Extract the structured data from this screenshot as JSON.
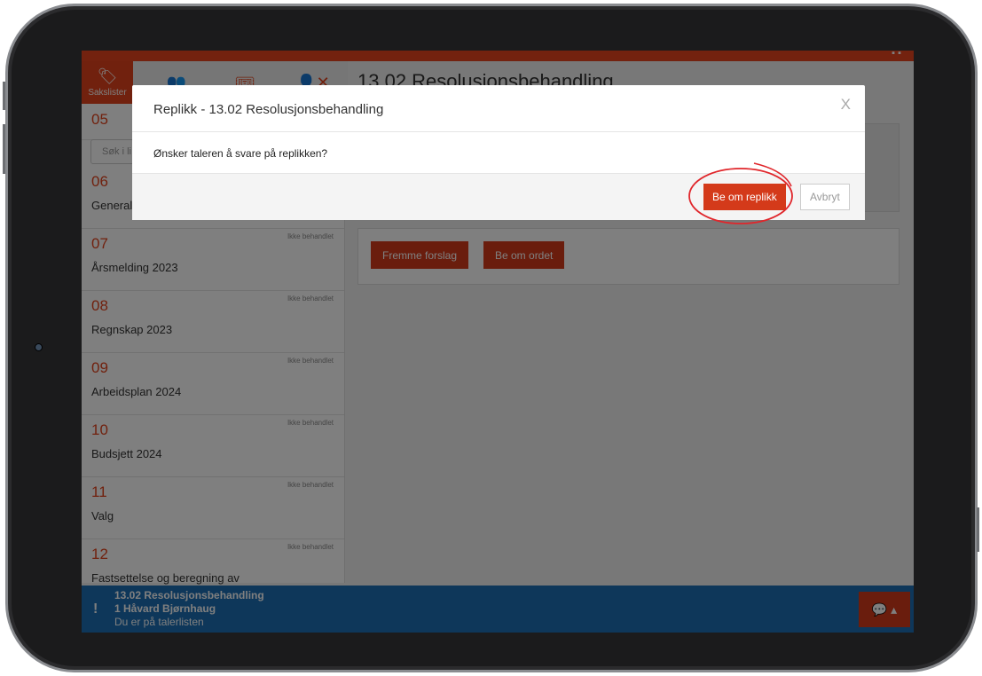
{
  "header": {
    "title": "13.02 Resolusjonsbehandling"
  },
  "tabs": [
    {
      "label": "Sakslister",
      "icon": "tags-icon"
    },
    {
      "label": "",
      "icon": "users-icon"
    },
    {
      "label": "",
      "icon": "ticket-icon"
    },
    {
      "label": "",
      "icon": "user-remove-icon"
    }
  ],
  "sidebar": {
    "search_placeholder": "Søk i li",
    "items": [
      {
        "num": "05",
        "title": "",
        "status": ""
      },
      {
        "num": "06",
        "title": "General",
        "status": ""
      },
      {
        "num": "07",
        "title": "Årsmelding 2023",
        "status": "Ikke behandlet"
      },
      {
        "num": "08",
        "title": "Regnskap 2023",
        "status": "Ikke behandlet"
      },
      {
        "num": "09",
        "title": "Arbeidsplan 2024",
        "status": "Ikke behandlet"
      },
      {
        "num": "10",
        "title": "Budsjett 2024",
        "status": "Ikke behandlet"
      },
      {
        "num": "11",
        "title": "Valg",
        "status": "Ikke behandlet"
      },
      {
        "num": "12",
        "title": "Fastsettelse og beregning av",
        "status": "Ikke behandlet"
      }
    ]
  },
  "actions": {
    "propose_label": "Fremme forslag",
    "request_floor_label": "Be om ordet"
  },
  "bottombar": {
    "line1": "13.02 Resolusjonsbehandling",
    "line2": "1 Håvard Bjørnhaug",
    "line3": "Du er på talerlisten"
  },
  "modal": {
    "title": "Replikk - 13.02 Resolusjonsbehandling",
    "close": "X",
    "body": "Ønsker taleren å svare på replikken?",
    "primary_label": "Be om replikk",
    "secondary_label": "Avbryt"
  },
  "colors": {
    "accent": "#d43a1a",
    "bottombar": "#1d6fb5",
    "highlight": "#e0262b"
  }
}
